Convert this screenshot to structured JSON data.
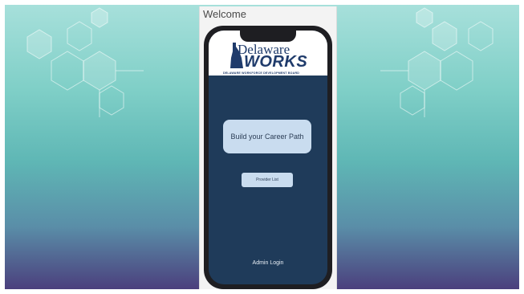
{
  "panel": {
    "title": "Welcome"
  },
  "logo": {
    "word1": "Delaware",
    "word2": "WORKS",
    "subtitle": "DELAWARE WORKFORCE DEVELOPMENT BOARD"
  },
  "buttons": {
    "career_path": "Build your Career Path",
    "provider_list": "Provider List",
    "admin_login": "Admin Login"
  },
  "colors": {
    "screen_bg": "#1f3b5a",
    "button_bg": "#c9dcef",
    "logo_blue": "#1f3b6b"
  }
}
